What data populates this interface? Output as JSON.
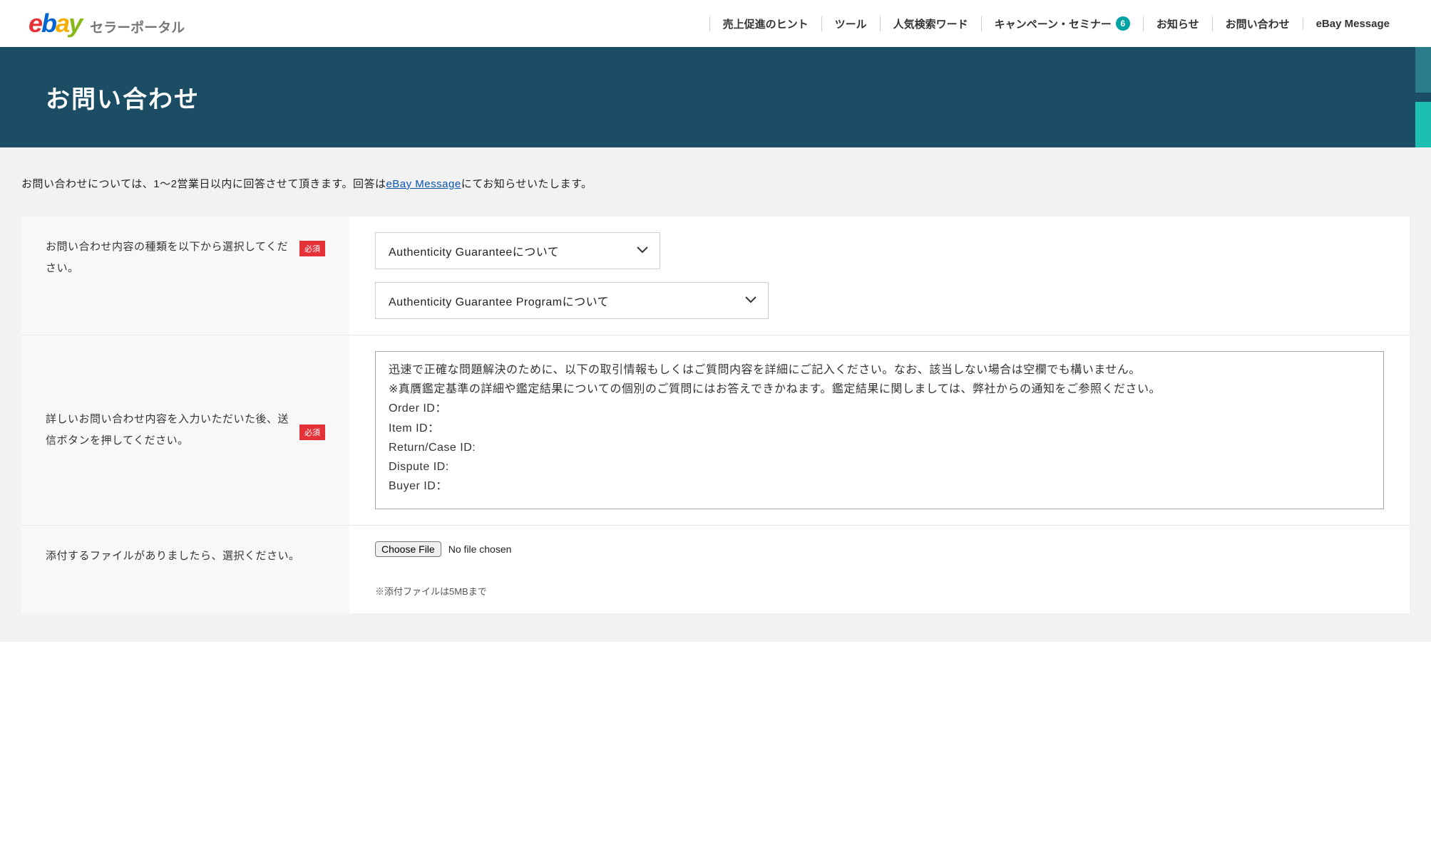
{
  "header": {
    "logo_sub": "セラーポータル",
    "nav": [
      {
        "label": "売上促進のヒント"
      },
      {
        "label": "ツール"
      },
      {
        "label": "人気検索ワード"
      },
      {
        "label": "キャンペーン・セミナー",
        "badge": "6"
      },
      {
        "label": "お知らせ"
      },
      {
        "label": "お問い合わせ"
      },
      {
        "label": "eBay Message"
      }
    ]
  },
  "hero": {
    "title": "お問い合わせ"
  },
  "intro": {
    "before": "お問い合わせについては、1～2営業日以内に回答させて頂きます。回答は",
    "link": "eBay Message",
    "after": "にてお知らせいたします。"
  },
  "form": {
    "type": {
      "label": "お問い合わせ内容の種類を以下から選択してください。",
      "required": "必須",
      "select1": "Authenticity Guaranteeについて",
      "select2": "Authenticity Guarantee Programについて"
    },
    "detail": {
      "label": "詳しいお問い合わせ内容を入力いただいた後、送信ボタンを押してください。",
      "required": "必須",
      "content": "迅速で正確な問題解決のために、以下の取引情報もしくはご質問内容を詳細にご記入ください。なお、該当しない場合は空欄でも構いません。\n※真贋鑑定基準の詳細や鑑定結果についての個別のご質問にはお答えできかねます。鑑定結果に関しましては、弊社からの通知をご参照ください。\nOrder ID：\nItem ID：\nReturn/Case ID:\nDispute ID:\nBuyer ID："
    },
    "attach": {
      "label": "添付するファイルがありましたら、選択ください。",
      "button": "Choose File",
      "status": "No file chosen",
      "note": "※添付ファイルは5MBまで"
    }
  }
}
